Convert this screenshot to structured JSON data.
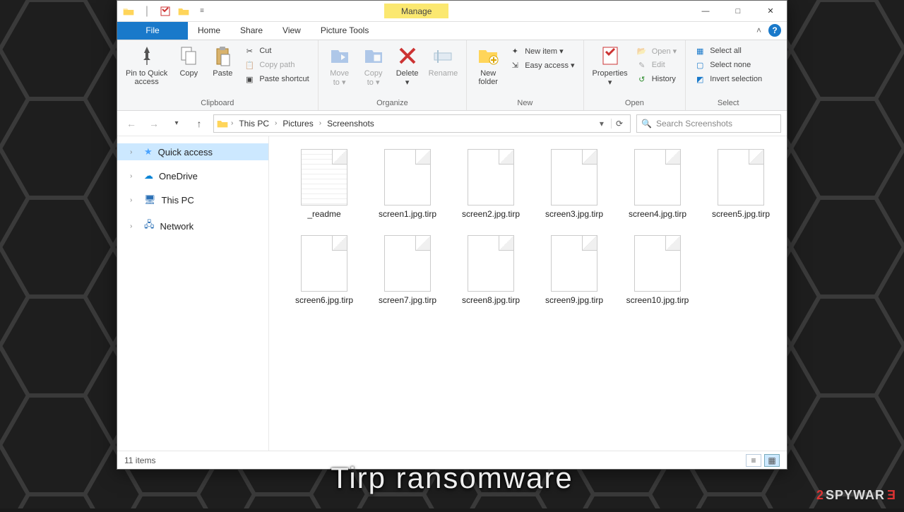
{
  "titlebar": {
    "manage_tab": "Manage",
    "minimize": "—",
    "maximize": "□",
    "close": "✕"
  },
  "ribbon_tabs": {
    "file": "File",
    "home": "Home",
    "share": "Share",
    "view": "View",
    "picture_tools": "Picture Tools",
    "help": "?"
  },
  "ribbon": {
    "pin": "Pin to Quick\naccess",
    "copy": "Copy",
    "paste": "Paste",
    "cut": "Cut",
    "copy_path": "Copy path",
    "paste_shortcut": "Paste shortcut",
    "clipboard_label": "Clipboard",
    "move_to": "Move\nto ▾",
    "copy_to": "Copy\nto ▾",
    "delete": "Delete\n▾",
    "rename": "Rename",
    "organize_label": "Organize",
    "new_folder": "New\nfolder",
    "new_item": "New item ▾",
    "easy_access": "Easy access ▾",
    "new_label": "New",
    "properties": "Properties\n▾",
    "open": "Open ▾",
    "edit": "Edit",
    "history": "History",
    "open_label": "Open",
    "select_all": "Select all",
    "select_none": "Select none",
    "invert_sel": "Invert selection",
    "select_label": "Select"
  },
  "nav": {
    "back": "←",
    "forward": "→",
    "recent": "▾",
    "up": "↑",
    "refresh": "⟳",
    "drop": "▾"
  },
  "breadcrumb": [
    "This PC",
    "Pictures",
    "Screenshots"
  ],
  "search_placeholder": "Search Screenshots",
  "tree": {
    "quick_access": "Quick access",
    "onedrive": "OneDrive",
    "this_pc": "This PC",
    "network": "Network"
  },
  "files": [
    {
      "name": "_readme",
      "readme": true
    },
    {
      "name": "screen1.jpg.tirp"
    },
    {
      "name": "screen2.jpg.tirp"
    },
    {
      "name": "screen3.jpg.tirp"
    },
    {
      "name": "screen4.jpg.tirp"
    },
    {
      "name": "screen5.jpg.tirp"
    },
    {
      "name": "screen6.jpg.tirp"
    },
    {
      "name": "screen7.jpg.tirp"
    },
    {
      "name": "screen8.jpg.tirp"
    },
    {
      "name": "screen9.jpg.tirp"
    },
    {
      "name": "screen10.jpg.tirp"
    }
  ],
  "status": {
    "count": "11 items"
  },
  "caption": "Tirp  ransomware",
  "watermark": {
    "two": "2",
    "spy": "SPYWAR",
    "e": "E"
  }
}
